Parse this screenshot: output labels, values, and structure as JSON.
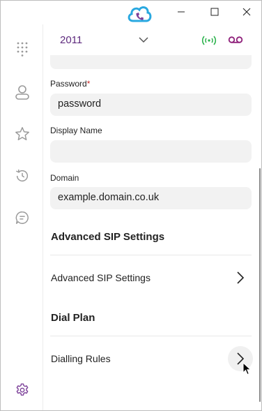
{
  "titlebar": {
    "controls": [
      "minimize",
      "maximize",
      "close"
    ]
  },
  "sidebar": {
    "items": [
      {
        "icon": "dialpad-icon"
      },
      {
        "icon": "contact-icon"
      },
      {
        "icon": "star-icon"
      },
      {
        "icon": "history-icon"
      },
      {
        "icon": "chat-icon"
      },
      {
        "icon": "settings-icon"
      }
    ]
  },
  "account": {
    "name": "2011",
    "registration_color": "#2bb24c",
    "voicemail_color": "#8e1f7a"
  },
  "form": {
    "password_label": "Password",
    "password_required": "*",
    "password_value": "password",
    "display_name_label": "Display Name",
    "display_name_value": "",
    "domain_label": "Domain",
    "domain_value": "example.domain.co.uk"
  },
  "sections": {
    "advanced_heading": "Advanced SIP Settings",
    "advanced_row": "Advanced SIP Settings",
    "dialplan_heading": "Dial Plan",
    "dialling_row": "Dialling Rules"
  },
  "colors": {
    "accent": "#7b3f98",
    "brand_blue": "#29a8e0"
  }
}
